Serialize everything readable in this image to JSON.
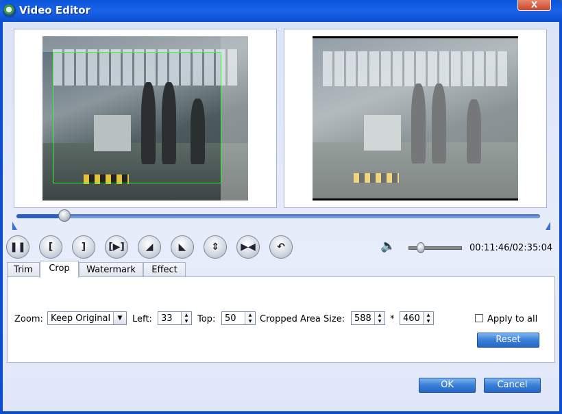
{
  "window": {
    "title": "Video Editor",
    "close_label": "X"
  },
  "seek": {
    "progress_fraction": 0.09
  },
  "controls": [
    {
      "name": "pause-button",
      "glyph": "❚❚"
    },
    {
      "name": "mark-in-button",
      "glyph": "["
    },
    {
      "name": "mark-out-button",
      "glyph": "]"
    },
    {
      "name": "next-frame-button",
      "glyph": "[▶]"
    },
    {
      "name": "rotate-left-button",
      "glyph": "◢"
    },
    {
      "name": "rotate-right-button",
      "glyph": "◣"
    },
    {
      "name": "flip-vertical-button",
      "glyph": "⇕"
    },
    {
      "name": "flip-horizontal-button",
      "glyph": "▶◀"
    },
    {
      "name": "undo-button",
      "glyph": "↶"
    }
  ],
  "volume": {
    "icon": "speaker-icon",
    "level_fraction": 0.22
  },
  "timecode": "00:11:46/02:35:04",
  "tabs": [
    "Trim",
    "Crop",
    "Watermark",
    "Effect"
  ],
  "active_tab": "Crop",
  "crop": {
    "zoom_label": "Zoom:",
    "zoom_value": "Keep Original",
    "left_label": "Left:",
    "left_value": "33",
    "top_label": "Top:",
    "top_value": "50",
    "size_label": "Cropped Area Size:",
    "width_value": "588",
    "times": "*",
    "height_value": "460",
    "apply_all_label": "Apply to all",
    "apply_all_checked": false,
    "reset_label": "Reset"
  },
  "footer": {
    "ok_label": "OK",
    "cancel_label": "Cancel"
  }
}
